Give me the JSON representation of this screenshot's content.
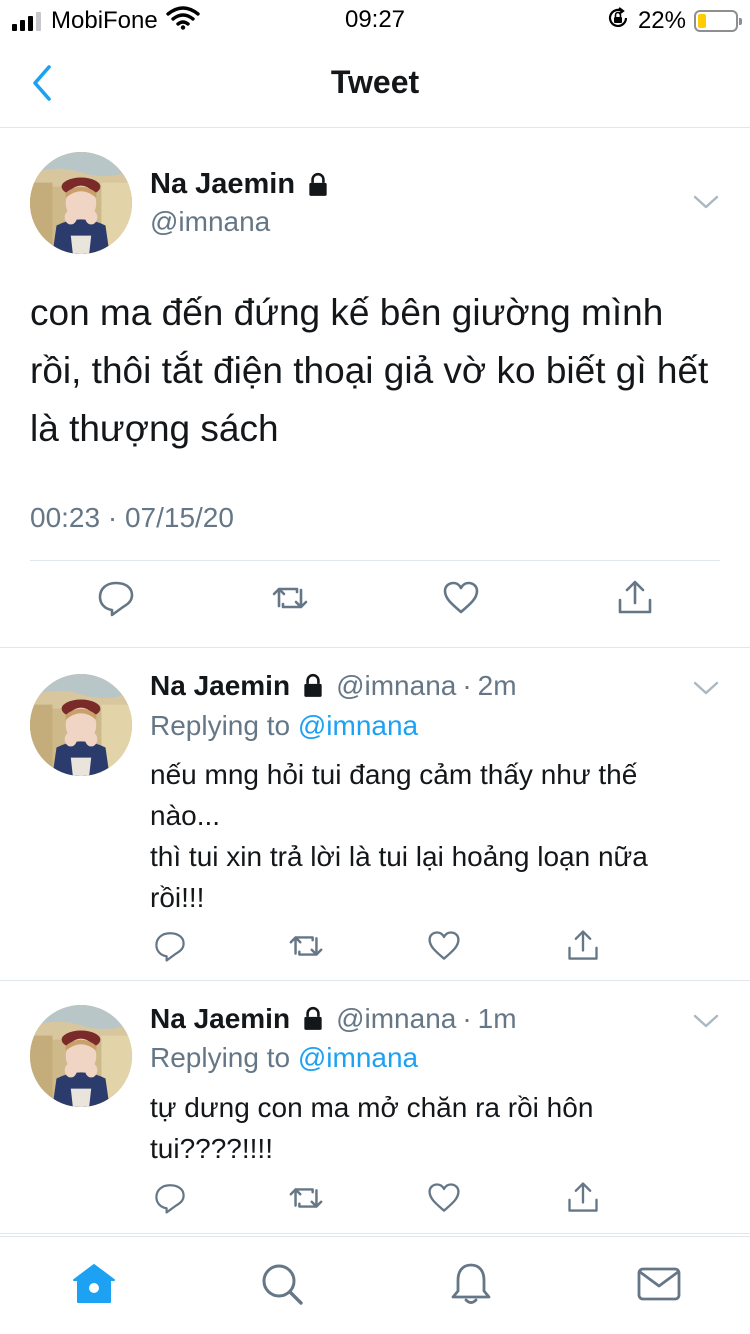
{
  "status_bar": {
    "carrier": "MobiFone",
    "time": "09:27",
    "battery_percent": "22%",
    "battery_level": 0.22,
    "battery_color": "#ffcc00"
  },
  "nav": {
    "title": "Tweet",
    "back_icon": "chevron-left-icon"
  },
  "accent_color": "#1da1f2",
  "main_tweet": {
    "name": "Na Jaemin",
    "handle": "@imnana",
    "text": "con ma đến đứng kế bên giường mình rồi, thôi tắt điện thoại giả vờ ko biết gì hết là thượng sách",
    "timestamp": "00:23 · 07/15/20",
    "actions": [
      "reply-icon",
      "retweet-icon",
      "like-icon",
      "share-icon"
    ]
  },
  "replies": [
    {
      "name": "Na Jaemin",
      "handle": "@imnana",
      "time": "2m",
      "replying_label": "Replying to",
      "replying_to": "@imnana",
      "text_lines": [
        "nếu mng hỏi tui đang cảm thấy như thế nào...",
        "thì tui xin trả lời là tui lại hoảng loạn nữa rồi!!!"
      ]
    },
    {
      "name": "Na Jaemin",
      "handle": "@imnana",
      "time": "1m",
      "replying_label": "Replying to",
      "replying_to": "@imnana",
      "text_lines": [
        "tự dưng con ma mở chăn ra rồi hôn tui????!!!!"
      ]
    }
  ],
  "tab_bar": {
    "tabs": [
      "home-icon",
      "search-icon",
      "notifications-icon",
      "messages-icon"
    ],
    "active": "home-icon"
  }
}
